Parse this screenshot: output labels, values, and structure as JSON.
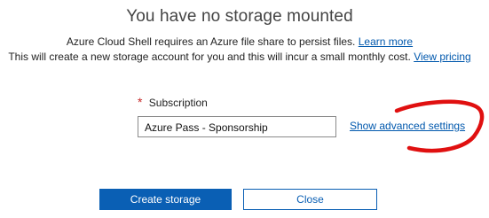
{
  "dialog": {
    "title": "You have no storage mounted",
    "line1_text": "Azure Cloud Shell requires an Azure file share to persist files.",
    "line1_link": "Learn more",
    "line2_text": "This will create a new storage account for you and this will incur a small monthly cost.",
    "line2_link": "View pricing"
  },
  "subscription": {
    "required_marker": "*",
    "label": "Subscription",
    "value": "Azure Pass - Sponsorship"
  },
  "advanced_link": "Show advanced settings",
  "buttons": {
    "create": "Create storage",
    "close": "Close"
  },
  "colors": {
    "primary": "#0a5fb4",
    "link": "#0058ad",
    "required": "#c62828",
    "annotation": "#e01010"
  }
}
